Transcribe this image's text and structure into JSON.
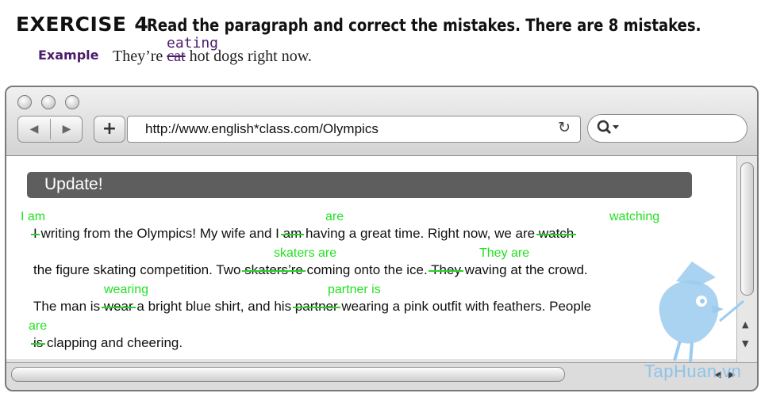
{
  "exercise": {
    "label": "EXERCISE",
    "number": "4",
    "instruction": "Read the paragraph and correct the mistakes. There are 8 mistakes."
  },
  "example": {
    "tag": "Example",
    "sentence_before": "They’re",
    "struck_word": "cat",
    "correction": "eating",
    "sentence_after": "hot dogs right now."
  },
  "browser": {
    "url": "http://www.english*class.com/Olympics",
    "banner_title": "Update!",
    "icons": [
      "back-icon",
      "forward-icon",
      "plus-icon",
      "reload-icon",
      "search-icon"
    ]
  },
  "paragraph": {
    "line1": {
      "err1": "I",
      "t1": " writing from the Olympics! My wife and I ",
      "err2": "am",
      "t2": " having a great time. Right now, we are ",
      "err3": "watch"
    },
    "line2": {
      "t1": "the figure skating competition. Two ",
      "err1": "skaters’re",
      "t2": " coming onto the ice. ",
      "err2": "They",
      "t3": " waving at the crowd."
    },
    "line3": {
      "t1": "The man is ",
      "err1": "wear",
      "t2": " a bright blue shirt, and his ",
      "err2": "partner",
      "t3": " wearing a pink outfit with feathers. People"
    },
    "line4": {
      "err1": "is",
      "t1": " clapping and cheering."
    }
  },
  "corrections": {
    "c1": "I am",
    "c2": "are",
    "c3": "watching",
    "c4": "skaters are",
    "c5": "They are",
    "c6": "wearing",
    "c7": "partner is",
    "c8": "are"
  },
  "watermark": "TapHuan.vn",
  "colors": {
    "correction": "#22e022",
    "example": "#4b1c6a",
    "banner": "#5e5e5e"
  }
}
